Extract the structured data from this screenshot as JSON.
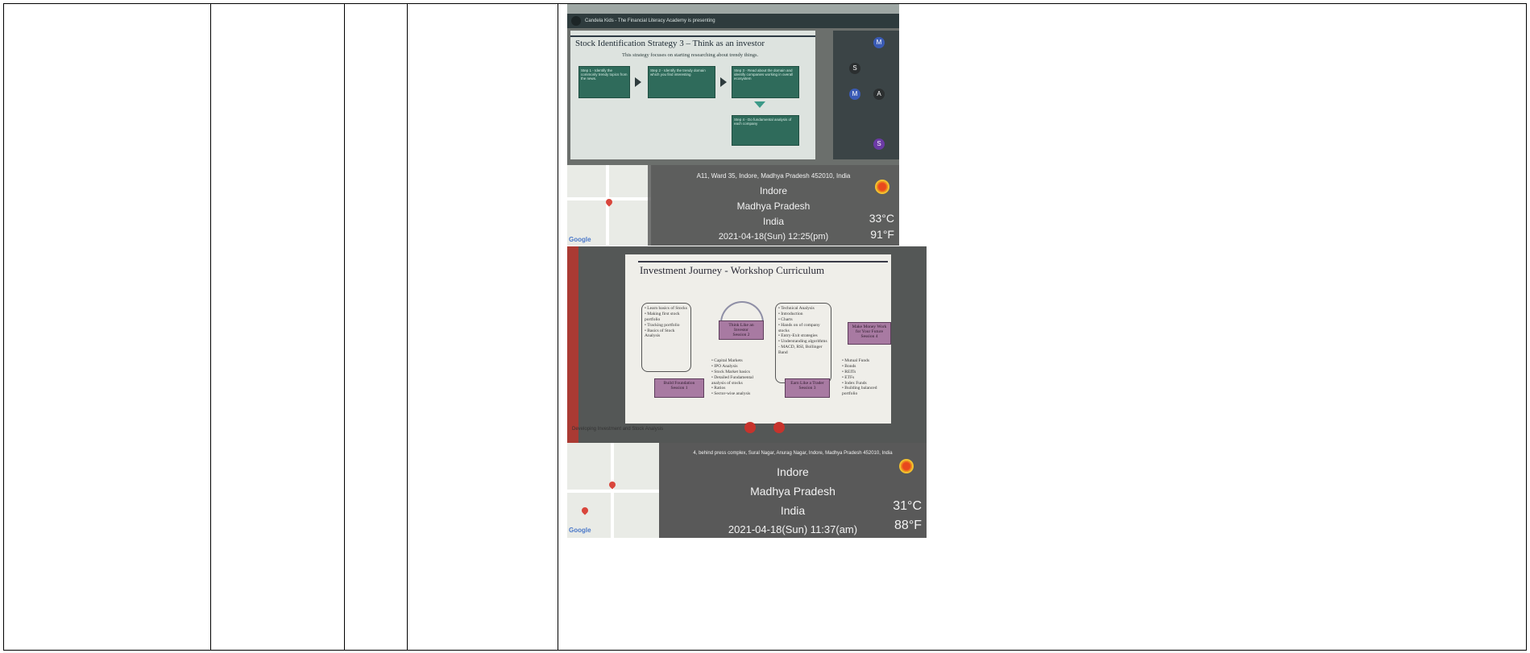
{
  "photo1": {
    "meet_title": "Candela Kids - The Financial Literacy Academy is presenting",
    "slide_title": "Stock Identification Strategy 3 – Think as an investor",
    "slide_subtitle": "This strategy focuses on  starting researching about trendy things.",
    "steps": [
      "Step 1 - Identify the commonly trendy topics from the news.",
      "Step 2 - Identify the trendy domain which you find interesting",
      "Step 3 - Read about the domain and identify companies working in overall ecosystem",
      "Step 4 - Do fundamental analysis of each company"
    ],
    "participants": [
      "M",
      "S",
      "M",
      "A",
      "S"
    ],
    "address": "A11, Ward 35, Indore, Madhya Pradesh 452010, India",
    "city": "Indore",
    "state": "Madhya Pradesh",
    "country": "India",
    "datetime": "2021-04-18(Sun)  12:25(pm)",
    "temp_c": "33°C",
    "temp_f": "91°F"
  },
  "photo2": {
    "slide_title": "Investment Journey - Workshop Curriculum",
    "box1": "• Learn basics of Stocks\n• Making first stock portfolio\n• Tracking portfolio\n• Basics of Stock Analysis",
    "box2": "• Capital Markets\n  • IPO Analysis\n  • Stock Market basics\n• Detailed Fundamental analysis of stocks\n  • Ratios\n  • Sector-wise analysis",
    "box3": "• Technical Analysis\n  • Introduction\n  • Charts\n  • Hands on of company stocks\n• Entry-Exit strategies\n• Understanding algorithms - MACD, RSI, Bollinger Band",
    "box4": "• Mutual Funds\n• Bonds\n• REITs\n• ETFs\n• Index Funds\n• Building balanced portfolio",
    "sessions": [
      {
        "label": "Build Foundation",
        "session": "Session 1"
      },
      {
        "label": "Think Like an Investor",
        "session": "Session 2"
      },
      {
        "label": "Earn Like a Trader",
        "session": "Session 3"
      },
      {
        "label": "Make Money Work for Your Future",
        "session": "Session 4"
      }
    ],
    "footer": "Developing Investment and Stock Analysis",
    "address": "4, behind press complex, Sural Nagar, Anurag Nagar, Indore, Madhya Pradesh 452010, India",
    "city": "Indore",
    "state": "Madhya Pradesh",
    "country": "India",
    "datetime": "2021-04-18(Sun)  11:37(am)",
    "temp_c": "31°C",
    "temp_f": "88°F"
  },
  "map": {
    "logo": "Google"
  }
}
